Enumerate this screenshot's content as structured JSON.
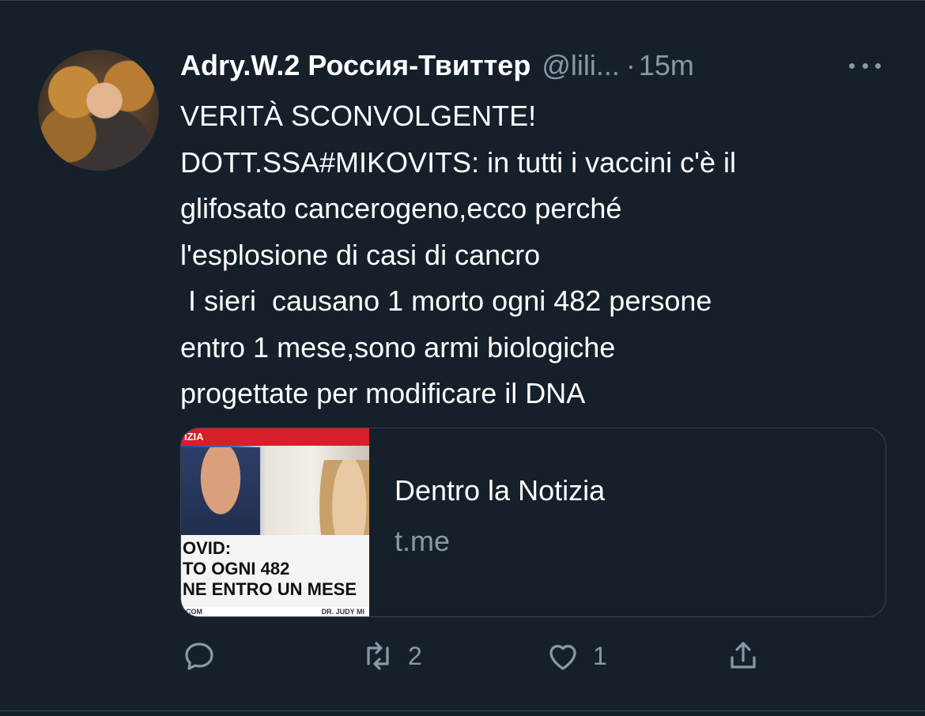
{
  "tweet": {
    "display_name": "Adry.W.2 Россия-Твиттер",
    "handle": "@lili...",
    "separator": "·",
    "time": "15m",
    "text_lines": [
      "VERITÀ SCONVOLGENTE!",
      "DOTT.SSA#MIKOVITS: in tutti i vaccini c'è il",
      "glifosato cancerogeno,ecco perché",
      "l'esplosione di casi di cancro",
      " I sieri  causano 1 morto ogni 482 persone",
      "entro 1 mese,sono armi biologiche",
      "progettate per modificare il DNA"
    ]
  },
  "card": {
    "title": "Dentro la Notizia",
    "domain": "t.me",
    "thumbnail": {
      "top_strip": "IZIA",
      "caption": "OVID:\nTO OGNI 482\nNE ENTRO UN MESE",
      "footer_left": "COM",
      "footer_right": "DR. JUDY MI"
    }
  },
  "actions": {
    "reply_icon": "reply-icon",
    "retweet_icon": "retweet-icon",
    "retweet_count": "2",
    "like_icon": "heart-icon",
    "like_count": "1",
    "share_icon": "share-icon"
  },
  "colors": {
    "background": "#15202b",
    "text_primary": "#ffffff",
    "text_secondary": "#8b98a5",
    "border": "#38444d"
  }
}
